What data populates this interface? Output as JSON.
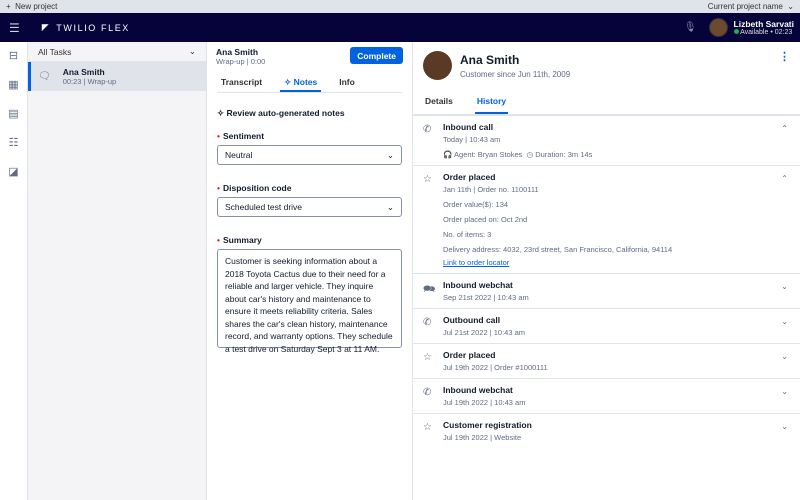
{
  "topbar": {
    "new_project": "New project",
    "project_name": "Current project name"
  },
  "header": {
    "brand": "TWILIO FLEX",
    "user_name": "Lizbeth Sarvati",
    "status": "Available",
    "time": "02:23",
    "status_color": "#14b053"
  },
  "tasks": {
    "filter": "All Tasks",
    "items": [
      {
        "name": "Ana Smith",
        "time": "00:23",
        "state": "Wrap-up"
      }
    ]
  },
  "task": {
    "name": "Ana Smith",
    "state": "Wrap-up",
    "time": "0:00",
    "complete": "Complete",
    "tabs": [
      "Transcript",
      "Notes",
      "Info"
    ],
    "active_tab": "Notes",
    "review": "Review auto-generated notes",
    "sentiment_label": "Sentiment",
    "sentiment": "Neutral",
    "disposition_label": "Disposition code",
    "disposition": "Scheduled test drive",
    "summary_label": "Summary",
    "summary": "Customer is seeking information about a 2018 Toyota Cactus due to their need for a reliable and larger vehicle. They inquire about car's history and maintenance to ensure it meets reliability criteria. Sales shares the car's clean history, maintenance record, and warranty options. They schedule a  test drive on Saturday Sept 3 at 11 AM."
  },
  "customer": {
    "name": "Ana Smith",
    "since": "Customer since Jun 11th, 2009",
    "tabs": [
      "Details",
      "History"
    ],
    "active_tab": "History"
  },
  "history": [
    {
      "icon": "phone-icon",
      "title": "Inbound call",
      "meta": [
        "Today",
        "10:43 am"
      ],
      "expanded": true,
      "agent": "Agent: Bryan Stokes",
      "duration": "Duration: 3m 14s"
    },
    {
      "icon": "star-icon",
      "title": "Order placed",
      "meta": [
        "Jan 11th",
        "Order no. 1100111"
      ],
      "expanded": true,
      "details": [
        "Order value($): 134",
        "Order placed on: Oct 2nd",
        "No. of items: 3",
        "Delivery address: 4032, 23rd street, San Francisco, California, 94114"
      ],
      "link": "Link to order locator"
    },
    {
      "icon": "chat-icon",
      "title": "Inbound webchat",
      "meta": [
        "Sep 21st 2022",
        "10:43 am"
      ]
    },
    {
      "icon": "phone-icon",
      "title": "Outbound call",
      "meta": [
        "Jul 21st 2022",
        "10:43 am"
      ]
    },
    {
      "icon": "star-icon",
      "title": "Order placed",
      "meta": [
        "Jul 19th 2022",
        "Order #1000111"
      ]
    },
    {
      "icon": "phone-icon",
      "title": "Inbound webchat",
      "meta": [
        "Jul 19th 2022",
        "10:43 am"
      ]
    },
    {
      "icon": "star-icon",
      "title": "Customer registration",
      "meta": [
        "Jul 19th 2022",
        "Website"
      ]
    }
  ]
}
